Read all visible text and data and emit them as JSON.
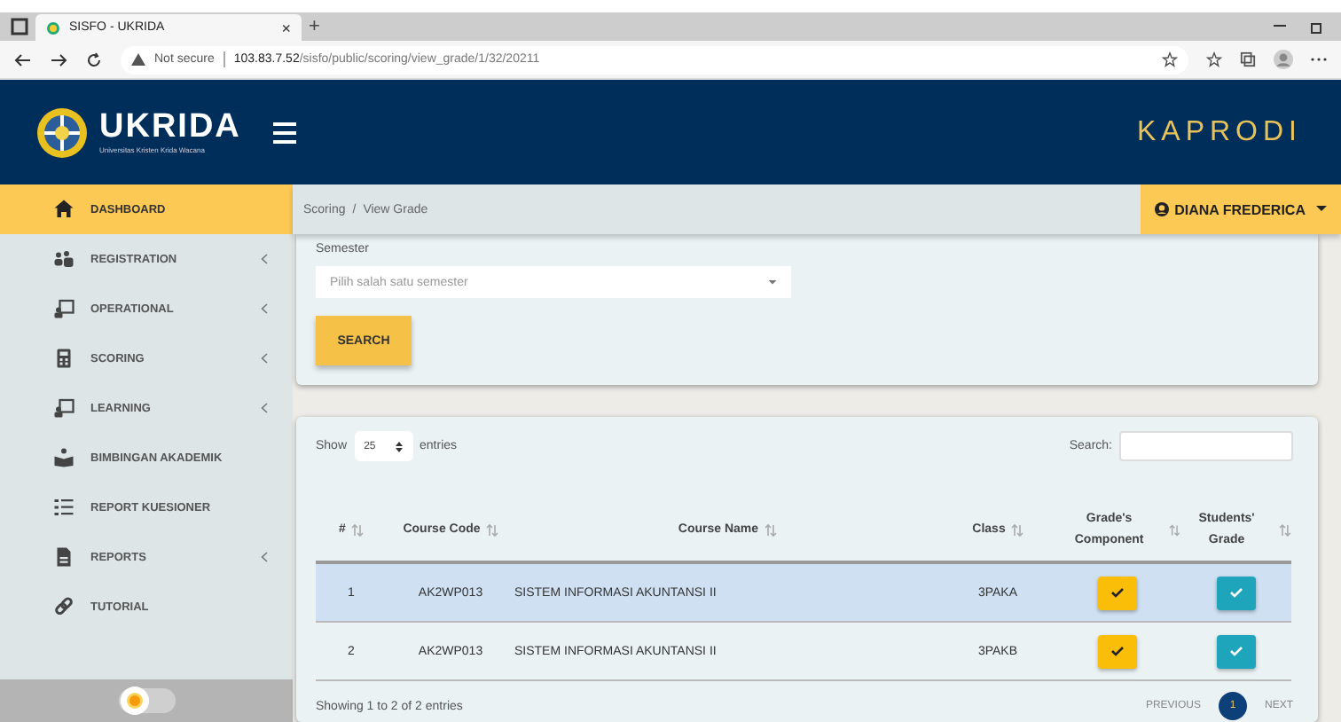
{
  "browser": {
    "tab_title": "SISFO - UKRIDA",
    "tab_close": "×",
    "new_tab": "+",
    "security": "Not secure",
    "url_host": "103.83.7.52",
    "url_path": "/sisfo/public/scoring/view_grade/1/32/20211"
  },
  "header": {
    "logo_name": "UKRIDA",
    "logo_subtitle": "Universitas Kristen Krida Wacana",
    "role": "KAPRODI"
  },
  "sidebar": {
    "items": [
      {
        "label": "DASHBOARD",
        "selected": true,
        "expandable": false
      },
      {
        "label": "REGISTRATION",
        "selected": false,
        "expandable": true
      },
      {
        "label": "OPERATIONAL",
        "selected": false,
        "expandable": true
      },
      {
        "label": "SCORING",
        "selected": false,
        "expandable": true
      },
      {
        "label": "LEARNING",
        "selected": false,
        "expandable": true
      },
      {
        "label": "BIMBINGAN AKADEMIK",
        "selected": false,
        "expandable": false
      },
      {
        "label": "REPORT KUESIONER",
        "selected": false,
        "expandable": false
      },
      {
        "label": "REPORTS",
        "selected": false,
        "expandable": true
      },
      {
        "label": "TUTORIAL",
        "selected": false,
        "expandable": false
      }
    ],
    "theme_toggle": {
      "on": false
    }
  },
  "breadcrumb": [
    "Scoring",
    "/",
    "View Grade"
  ],
  "user_menu": {
    "name": "DIANA FREDERICA"
  },
  "filter": {
    "label": "Semester",
    "placeholder": "Pilih salah satu semester",
    "button": "SEARCH"
  },
  "table": {
    "show_label": "Show",
    "page_size": "25",
    "entries_label": "entries",
    "search_label": "Search:",
    "columns": [
      "#",
      "Course Code",
      "Course Name",
      "Class",
      "Grade's Component",
      "Students' Grade"
    ],
    "rows": [
      {
        "number": "1",
        "course_code": "AK2WP013",
        "course_name": "SISTEM INFORMASI AKUNTANSI II",
        "class": "3PAKA",
        "selected": true
      },
      {
        "number": "2",
        "course_code": "AK2WP013",
        "course_name": "SISTEM INFORMASI AKUNTANSI II",
        "class": "3PAKB",
        "selected": false
      }
    ],
    "info": "Showing 1 to 2 of 2 entries",
    "pagination": {
      "previous": "PREVIOUS",
      "pages": [
        {
          "label": "1",
          "selected": true
        }
      ],
      "next": "NEXT"
    }
  }
}
